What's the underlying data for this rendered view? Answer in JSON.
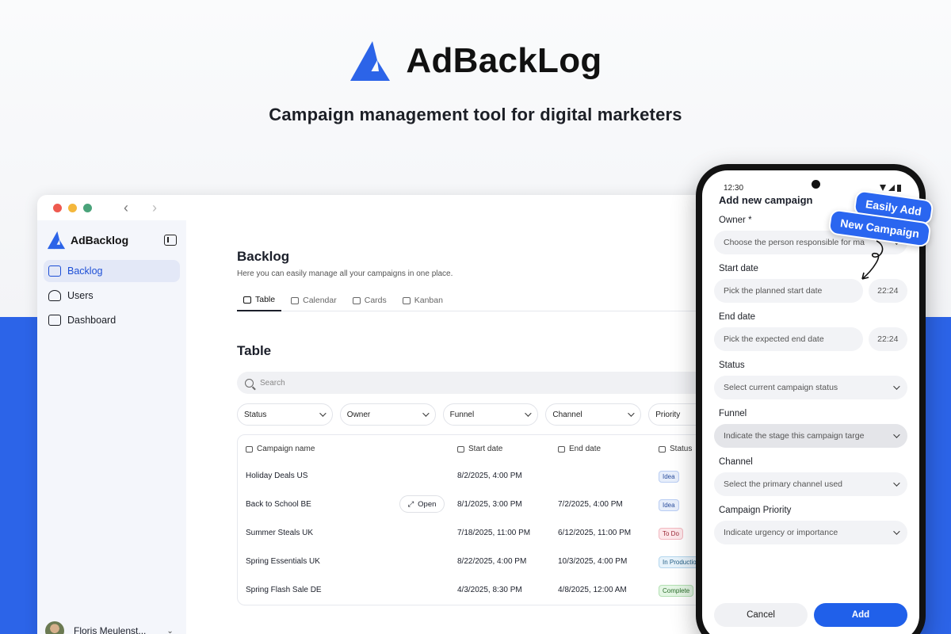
{
  "hero": {
    "brand": "AdBackLog",
    "tagline": "Campaign management tool for digital marketers"
  },
  "colors": {
    "accent": "#2c64e8",
    "window_dot_red": "#ee5a4f",
    "window_dot_yellow": "#f4b73c",
    "window_dot_green": "#4aa37a"
  },
  "sidebar": {
    "brand": "AdBacklog",
    "items": [
      {
        "label": "Backlog",
        "icon": "archive-icon",
        "active": true
      },
      {
        "label": "Users",
        "icon": "users-icon"
      },
      {
        "label": "Dashboard",
        "icon": "chart-icon"
      }
    ],
    "user_name": "Floris Meulenst..."
  },
  "main": {
    "title": "Backlog",
    "subtitle": "Here you can easily manage all your campaigns in one place.",
    "tabs": [
      "Table",
      "Calendar",
      "Cards",
      "Kanban"
    ],
    "section_title": "Table",
    "search_placeholder": "Search",
    "filters": [
      "Status",
      "Owner",
      "Funnel",
      "Channel",
      "Priority"
    ],
    "columns": [
      "Campaign name",
      "Start date",
      "End date",
      "Status"
    ],
    "open_label": "Open",
    "rows": [
      {
        "name": "Holiday Deals US",
        "start": "8/2/2025, 4:00 PM",
        "end": "",
        "status": "Idea"
      },
      {
        "name": "Back to School BE",
        "start": "8/1/2025, 3:00 PM",
        "end": "7/2/2025, 4:00 PM",
        "status": "Idea"
      },
      {
        "name": "Summer Steals UK",
        "start": "7/18/2025, 11:00 PM",
        "end": "6/12/2025, 11:00 PM",
        "status": "To Do"
      },
      {
        "name": "Spring Essentials UK",
        "start": "8/22/2025, 4:00 PM",
        "end": "10/3/2025, 4:00 PM",
        "status": "In Productio"
      },
      {
        "name": "Spring Flash Sale DE",
        "start": "4/3/2025, 8:30 PM",
        "end": "4/8/2025, 12:00 AM",
        "status": "Complete"
      }
    ]
  },
  "phone": {
    "time": "12:30",
    "title": "Add new campaign",
    "owner_label": "Owner *",
    "owner_placeholder": "Choose the person responsible for ma",
    "start_label": "Start date",
    "start_placeholder": "Pick the planned start date",
    "start_time": "22:24",
    "end_label": "End date",
    "end_placeholder": "Pick the expected end date",
    "end_time": "22:24",
    "status_label": "Status",
    "status_placeholder": "Select current campaign status",
    "funnel_label": "Funnel",
    "funnel_placeholder": "Indicate the stage this campaign targe",
    "channel_label": "Channel",
    "channel_placeholder": "Select the primary channel used",
    "priority_label": "Campaign Priority",
    "priority_placeholder": "Indicate urgency or importance",
    "cancel_label": "Cancel",
    "add_label": "Add"
  },
  "callouts": {
    "line1": "Easily Add",
    "line2": "New Campaign"
  }
}
